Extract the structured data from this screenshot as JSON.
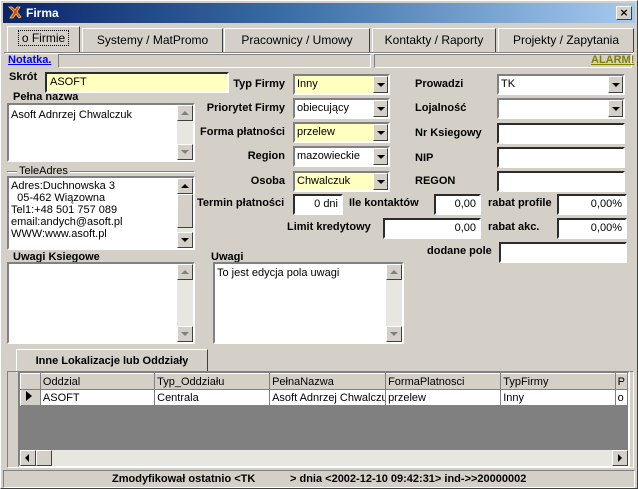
{
  "window": {
    "title": "Firma",
    "close_symbol": "×"
  },
  "tabs": [
    {
      "label": "o Firmie"
    },
    {
      "label": "Systemy / MatPromo"
    },
    {
      "label": "Pracownicy / Umowy"
    },
    {
      "label": "Kontakty / Raporty"
    },
    {
      "label": "Projekty / Zapytania"
    }
  ],
  "notatka_link": "Notatka.",
  "alarm_link": "ALARM!",
  "left": {
    "skrot_label": "Skrót",
    "skrot_value": "ASOFT",
    "pelna_nazwa_label": "Pełna nazwa",
    "pelna_nazwa_value": "Asoft Adnrzej Chwalczuk",
    "teleadres_label": "TeleAdres",
    "teleadres_lines": [
      "Adres:Duchnowska 3",
      "  05-462 Wiązowna",
      "Tel1:+48 501 757 089",
      "email:andych@asoft.pl",
      "WWW:www.asoft.pl"
    ],
    "uwagi_ksiegowe_label": "Uwagi Ksiegowe",
    "uwagi_ksiegowe_value": ""
  },
  "middle": {
    "typ_firmy_label": "Typ Firmy",
    "typ_firmy_value": "Inny",
    "priorytet_label": "Priorytet Firmy",
    "priorytet_value": "obiecujący",
    "forma_platnosci_label": "Forma płatności",
    "forma_platnosci_value": "przelew",
    "region_label": "Region",
    "region_value": "mazowieckie",
    "osoba_label": "Osoba",
    "osoba_value": "Chwalczuk",
    "termin_label": "Termin płatności",
    "termin_value": "0 dni",
    "ile_kontaktow_label": "Ile kontaktów",
    "ile_kontaktow_value": "0,00",
    "limit_label": "Limit kredytowy",
    "limit_value": "0,00",
    "uwagi_label": "Uwagi",
    "uwagi_value": "To jest edycja pola uwagi"
  },
  "right": {
    "prowadzi_label": "Prowadzi",
    "prowadzi_value": "TK",
    "lojalnosc_label": "Lojalność",
    "lojalnosc_value": "",
    "nr_ksiegowy_label": "Nr Ksiegowy",
    "nr_ksiegowy_value": "",
    "nip_label": "NIP",
    "nip_value": "",
    "regon_label": "REGON",
    "regon_value": "",
    "rabat_profile_label": "rabat profile",
    "rabat_profile_value": "0,00%",
    "rabat_akc_label": "rabat akc.",
    "rabat_akc_value": "0,00%",
    "dodane_pole_label": "dodane pole",
    "dodane_pole_value": ""
  },
  "locations": {
    "tab_label": "Inne Lokalizacje  lub Oddziały",
    "columns": [
      "Oddzial",
      "Typ_Oddziału",
      "PełnaNazwa",
      "FormaPlatnosci",
      "TypFirmy",
      "P"
    ],
    "rows": [
      [
        "ASOFT",
        "Centrala",
        "Asoft Adnrzej Chwalczuk",
        "przelew",
        "Inny",
        "o"
      ]
    ]
  },
  "status": {
    "modified_prefix": "Zmodyfikował ostatnio <TK",
    "modified_suffix": "> dnia <2002-12-10 09:42:31> ind->>20000002"
  }
}
